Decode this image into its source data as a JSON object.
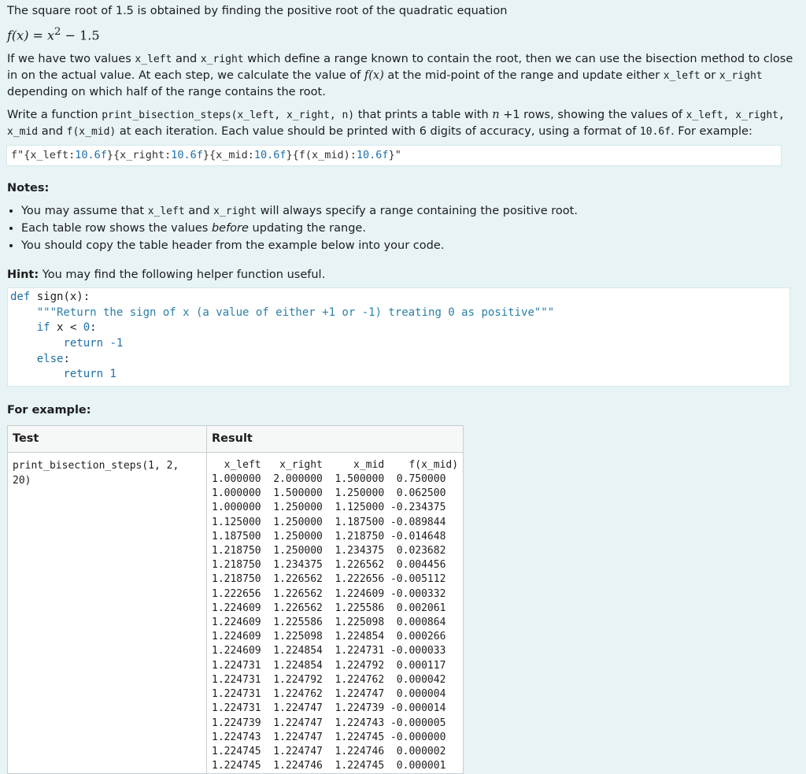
{
  "intro": {
    "line1": "The square root of 1.5 is obtained by finding the positive root of the quadratic equation",
    "equation_lhs": "f(x) = x",
    "equation_sup": "2",
    "equation_rhs": " − 1.5"
  },
  "para2": {
    "t1": "If we have two values ",
    "c1": "x_left",
    "t2": " and ",
    "c2": "x_right",
    "t3": " which define a range known to contain the root, then we can use the bisection method to close in on the actual value. At each step, we calculate the value of ",
    "m1": "f(x)",
    "t4": " at the mid-point of the range and update either ",
    "c3": "x_left",
    "t5": " or ",
    "c4": "x_right",
    "t6": " depending on which half of the range contains the root."
  },
  "para3": {
    "t1": "Write a function ",
    "c1": "print_bisection_steps(x_left, x_right, n)",
    "t2": " that prints a table with ",
    "m1": "n",
    "t3": " +1 rows, showing the values of ",
    "c2": "x_left, x_right, x_mid",
    "t4": " and ",
    "c3": "f(x_mid)",
    "t5": " at each iteration. Each value should be printed with 6 digits of accuracy, using a format of ",
    "c4": "10.6f",
    "t6": ". For example:"
  },
  "format_string": {
    "a": "f\"{x_left:",
    "b": "10.6f",
    "c": "}{x_right:",
    "d": "10.6f",
    "e": "}{x_mid:",
    "f": "10.6f",
    "g": "}{f(x_mid):",
    "h": "10.6f",
    "i": "}\""
  },
  "notes": {
    "title": "Notes:",
    "item1": {
      "t1": "You may assume that ",
      "c1": "x_left",
      "t2": " and ",
      "c2": "x_right",
      "t3": " will always specify a range containing the positive root."
    },
    "item2": {
      "t1": "Each table row shows the values ",
      "em": "before",
      "t2": " updating the range."
    },
    "item3": "You should copy the table header from the example below into your code."
  },
  "hint": {
    "label": "Hint:",
    "text": " You may find the following helper function useful."
  },
  "helper_code": {
    "l1_kw": "def",
    "l1": " sign(x):",
    "l2": "    \"\"\"Return the sign of x (a value of either +1 or -1) treating 0 as positive\"\"\"",
    "l3_kw": "if",
    "l3a": " x < ",
    "l3n": "0",
    "l3b": ":",
    "l4_kw": "return",
    "l4n": "-1",
    "l5_kw": "else",
    "l5b": ":",
    "l6_kw": "return",
    "l6n": "1"
  },
  "example": {
    "title": "For example:",
    "col_test": "Test",
    "col_result": "Result",
    "test_call": "print_bisection_steps(1, 2, 20)",
    "result_lines": [
      "  x_left   x_right     x_mid    f(x_mid)",
      "1.000000  2.000000  1.500000  0.750000",
      "1.000000  1.500000  1.250000  0.062500",
      "1.000000  1.250000  1.125000 -0.234375",
      "1.125000  1.250000  1.187500 -0.089844",
      "1.187500  1.250000  1.218750 -0.014648",
      "1.218750  1.250000  1.234375  0.023682",
      "1.218750  1.234375  1.226562  0.004456",
      "1.218750  1.226562  1.222656 -0.005112",
      "1.222656  1.226562  1.224609 -0.000332",
      "1.224609  1.226562  1.225586  0.002061",
      "1.224609  1.225586  1.225098  0.000864",
      "1.224609  1.225098  1.224854  0.000266",
      "1.224609  1.224854  1.224731 -0.000033",
      "1.224731  1.224854  1.224792  0.000117",
      "1.224731  1.224792  1.224762  0.000042",
      "1.224731  1.224762  1.224747  0.000004",
      "1.224731  1.224747  1.224739 -0.000014",
      "1.224739  1.224747  1.224743 -0.000005",
      "1.224743  1.224747  1.224745 -0.000000",
      "1.224745  1.224747  1.224746  0.000002",
      "1.224745  1.224746  1.224745  0.000001"
    ]
  }
}
